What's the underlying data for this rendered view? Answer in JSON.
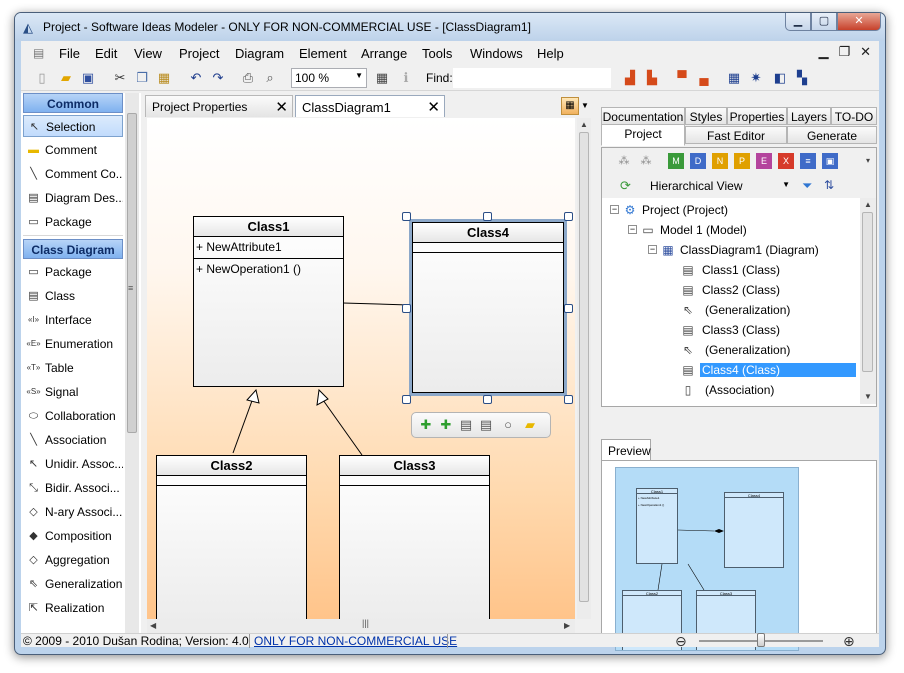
{
  "window": {
    "title": "Project - Software Ideas Modeler - ONLY FOR NON-COMMERCIAL USE - [ClassDiagram1]",
    "minimize_label": "▁",
    "maximize_label": "▢",
    "close_label": "✕"
  },
  "menu": {
    "items": [
      "File",
      "Edit",
      "View",
      "Project",
      "Diagram",
      "Element",
      "Arrange",
      "Tools",
      "Windows",
      "Help"
    ],
    "mdi_minimize": "▁",
    "mdi_restore": "❐",
    "mdi_close": "✕"
  },
  "toolbar": {
    "zoom_value": "100 %",
    "find_label": "Find:",
    "find_value": ""
  },
  "toolbox": {
    "common_header": "Common",
    "common_items": [
      {
        "label": "Selection",
        "icon": "cursor-icon",
        "glyph": "↖"
      },
      {
        "label": "Comment",
        "icon": "comment-icon",
        "glyph": "▬"
      },
      {
        "label": "Comment  Co...",
        "icon": "comment-connector-icon",
        "glyph": "╲"
      },
      {
        "label": "Diagram Des...",
        "icon": "diagram-description-icon",
        "glyph": "▤"
      },
      {
        "label": "Package",
        "icon": "package-icon",
        "glyph": "▭"
      }
    ],
    "class_header": "Class Diagram",
    "class_items": [
      {
        "label": "Package",
        "icon": "package-icon",
        "glyph": "▭"
      },
      {
        "label": "Class",
        "icon": "class-icon",
        "glyph": "▤"
      },
      {
        "label": "Interface",
        "icon": "interface-icon",
        "glyph": "«I»"
      },
      {
        "label": "Enumeration",
        "icon": "enumeration-icon",
        "glyph": "«E»"
      },
      {
        "label": "Table",
        "icon": "table-icon",
        "glyph": "«T»"
      },
      {
        "label": "Signal",
        "icon": "signal-icon",
        "glyph": "«S»"
      },
      {
        "label": "Collaboration",
        "icon": "collaboration-icon",
        "glyph": "⬭"
      },
      {
        "label": "Association",
        "icon": "association-icon",
        "glyph": "╲"
      },
      {
        "label": "Unidir. Assoc...",
        "icon": "unidirectional-association-icon",
        "glyph": "↖"
      },
      {
        "label": "Bidir. Associ...",
        "icon": "bidirectional-association-icon",
        "glyph": "⤡"
      },
      {
        "label": "N-ary Associ...",
        "icon": "nary-association-icon",
        "glyph": "◇"
      },
      {
        "label": "Composition",
        "icon": "composition-icon",
        "glyph": "◆"
      },
      {
        "label": "Aggregation",
        "icon": "aggregation-icon",
        "glyph": "◇"
      },
      {
        "label": "Generalization",
        "icon": "generalization-icon",
        "glyph": "⇖"
      },
      {
        "label": "Realization",
        "icon": "realization-icon",
        "glyph": "⇱"
      }
    ]
  },
  "document": {
    "tabs": [
      {
        "label": "Project Properties"
      },
      {
        "label": "ClassDiagram1"
      }
    ],
    "classes": {
      "class1": {
        "name": "Class1",
        "attribute": "+ NewAttribute1",
        "operation": "+ NewOperation1 ()"
      },
      "class2": {
        "name": "Class2"
      },
      "class3": {
        "name": "Class3"
      },
      "class4": {
        "name": "Class4"
      }
    }
  },
  "right": {
    "tabs_row1": [
      "Documentation",
      "Styles",
      "Properties",
      "Layers",
      "TO-DO"
    ],
    "tabs_row2": [
      "Project",
      "Fast Editor",
      "Generate"
    ],
    "view_mode": "Hierarchical View",
    "tree": [
      {
        "label": "Project (Project)",
        "icon": "project-icon"
      },
      {
        "label": "Model 1 (Model)",
        "icon": "model-icon"
      },
      {
        "label": "ClassDiagram1 (Diagram)",
        "icon": "diagram-icon"
      },
      {
        "label": "Class1 (Class)",
        "icon": "class-icon"
      },
      {
        "label": "Class2 (Class)",
        "icon": "class-icon"
      },
      {
        "label": "(Generalization)",
        "icon": "generalization-icon"
      },
      {
        "label": "Class3 (Class)",
        "icon": "class-icon"
      },
      {
        "label": "(Generalization)",
        "icon": "generalization-icon"
      },
      {
        "label": "Class4 (Class)",
        "icon": "class-icon"
      },
      {
        "label": "(Association)",
        "icon": "association-icon"
      }
    ],
    "preview_tab": "Preview",
    "preview_classes": {
      "class1": {
        "name": "Class1",
        "attribute": "+ NewAttribute1",
        "operation": "+ NewOperation1 ()"
      },
      "class2": "Class2",
      "class3": "Class3",
      "class4": "Class4"
    }
  },
  "status": {
    "copyright": "© 2009 - 2010 Dušan Rodina; Version: 4.0",
    "license_link": "ONLY FOR NON-COMMERCIAL USE",
    "zoom_fraction": 0.5
  }
}
